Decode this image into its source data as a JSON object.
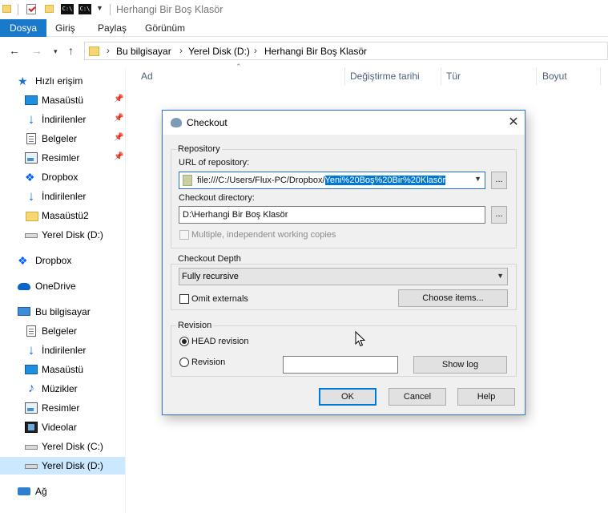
{
  "window": {
    "title": "Herhangi Bir Boş Klasör"
  },
  "ribbon": {
    "tabs": [
      "Dosya",
      "Giriş",
      "Paylaş",
      "Görünüm"
    ]
  },
  "address": {
    "crumbs": [
      "Bu bilgisayar",
      "Yerel Disk (D:)",
      "Herhangi Bir Boş Klasör"
    ]
  },
  "sidebar": {
    "items": [
      {
        "label": "Hızlı erişim",
        "icon": "star-icon"
      },
      {
        "label": "Masaüstü",
        "icon": "desktop-icon",
        "pinned": true
      },
      {
        "label": "İndirilenler",
        "icon": "download-icon",
        "pinned": true
      },
      {
        "label": "Belgeler",
        "icon": "documents-icon",
        "pinned": true
      },
      {
        "label": "Resimler",
        "icon": "pictures-icon",
        "pinned": true
      },
      {
        "label": "Dropbox",
        "icon": "dropbox-icon"
      },
      {
        "label": "İndirilenler",
        "icon": "download-icon"
      },
      {
        "label": "Masaüstü2",
        "icon": "folder-icon"
      },
      {
        "label": "Yerel Disk (D:)",
        "icon": "drive-icon"
      },
      {
        "label": "Dropbox",
        "icon": "dropbox-icon"
      },
      {
        "label": "OneDrive",
        "icon": "onedrive-icon"
      },
      {
        "label": "Bu bilgisayar",
        "icon": "computer-icon"
      },
      {
        "label": "Belgeler",
        "icon": "documents-icon"
      },
      {
        "label": "İndirilenler",
        "icon": "download-icon"
      },
      {
        "label": "Masaüstü",
        "icon": "desktop-icon"
      },
      {
        "label": "Müzikler",
        "icon": "music-icon"
      },
      {
        "label": "Resimler",
        "icon": "pictures-icon"
      },
      {
        "label": "Videolar",
        "icon": "videos-icon"
      },
      {
        "label": "Yerel Disk (C:)",
        "icon": "drive-icon"
      },
      {
        "label": "Yerel Disk (D:)",
        "icon": "drive-icon",
        "selected": true
      },
      {
        "label": "Ağ",
        "icon": "network-icon"
      }
    ]
  },
  "columns": [
    "Ad",
    "Değiştirme tarihi",
    "Tür",
    "Boyut"
  ],
  "dialog": {
    "title": "Checkout",
    "repository": {
      "group_label": "Repository",
      "url_label": "URL of repository:",
      "url_prefix": "file:///C:/Users/Flux-PC/Dropbox/",
      "url_selected": "Yeni%20Boş%20Bir%20Klasör",
      "browse": "...",
      "dir_label": "Checkout directory:",
      "dir_value": "D:\\Herhangi Bir Boş Klasör",
      "multiple_label": "Multiple, independent working copies"
    },
    "depth": {
      "group_label": "Checkout Depth",
      "value": "Fully recursive",
      "omit_label": "Omit externals",
      "choose_items": "Choose items..."
    },
    "revision": {
      "group_label": "Revision",
      "head_label": "HEAD revision",
      "rev_label": "Revision",
      "rev_value": "",
      "show_log": "Show log"
    },
    "buttons": {
      "ok": "OK",
      "cancel": "Cancel",
      "help": "Help"
    }
  },
  "colors": {
    "accent": "#1979ca",
    "selection": "#0078d7",
    "sidebar_selected": "#cce8ff"
  }
}
